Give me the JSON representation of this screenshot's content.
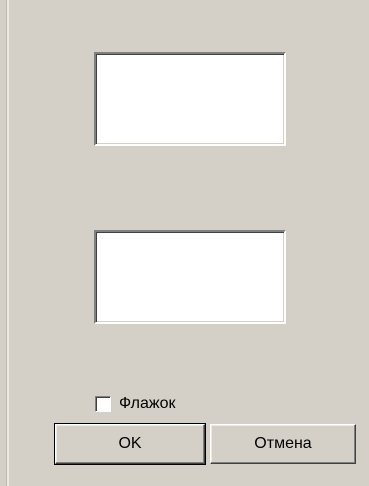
{
  "dialog": {
    "checkbox": {
      "label": "Флажок",
      "checked": false
    },
    "buttons": {
      "ok": "OK",
      "cancel": "Отмена"
    }
  }
}
